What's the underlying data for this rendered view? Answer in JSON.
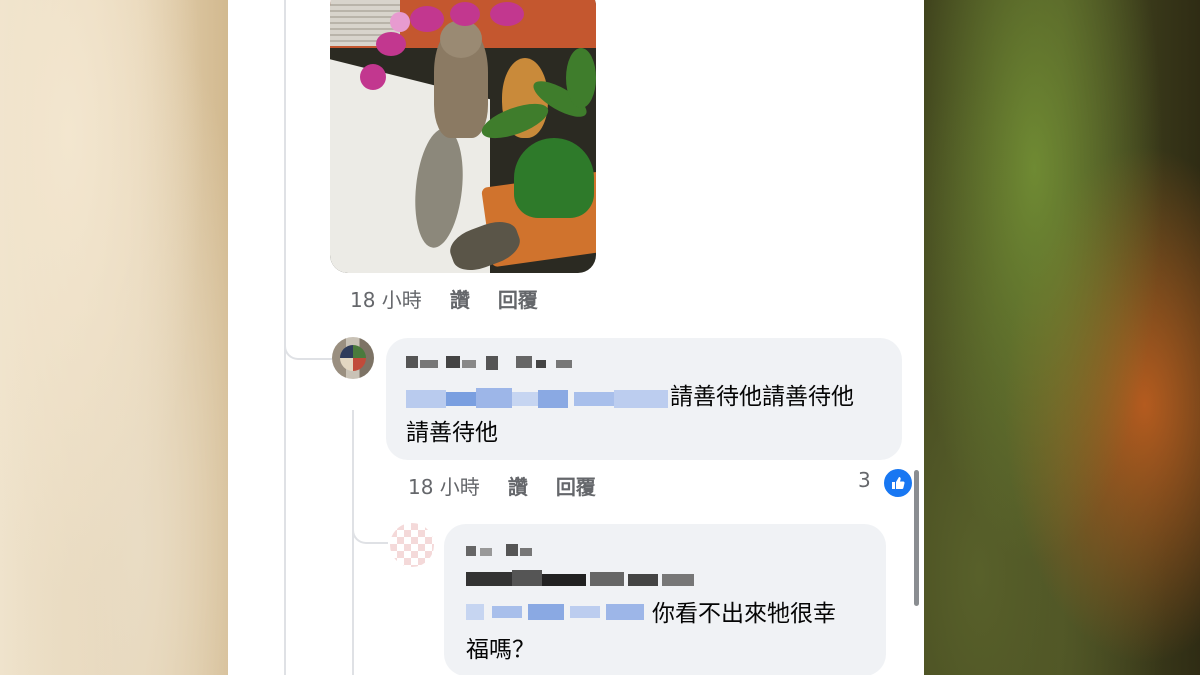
{
  "post": {
    "photo_alt": "cat-photo"
  },
  "photo_meta": {
    "time": "18 小時",
    "like": "讚",
    "reply": "回覆"
  },
  "comment1": {
    "text_line1": "請善待他請善待他",
    "text_line2": "請善待他",
    "meta": {
      "time": "18 小時",
      "like": "讚",
      "reply": "回覆"
    },
    "like_count": "3"
  },
  "comment2": {
    "text_line1": "你看不出來牠很幸",
    "text_line2": "福嗎？"
  },
  "colors": {
    "accent": "#1877f2",
    "bubble": "#f0f2f5",
    "meta_text": "#65676b",
    "body_text": "#050505"
  },
  "icons": {
    "like": "thumbs-up-icon"
  }
}
